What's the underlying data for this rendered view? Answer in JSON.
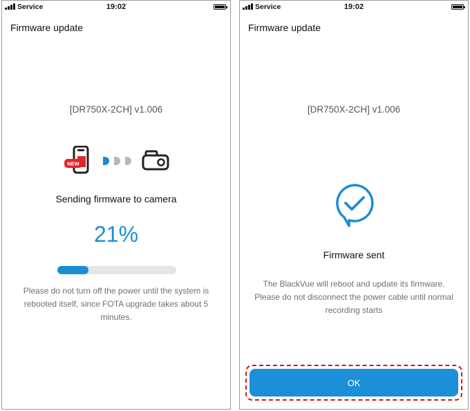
{
  "status_bar": {
    "carrier": "Service",
    "time": "19:02"
  },
  "left_screen": {
    "title": "Firmware update",
    "model": "[DR750X-2CH] v1.006",
    "new_badge": "NEW",
    "sending_text": "Sending firmware to camera",
    "progress_percent_text": "21%",
    "progress_fraction": 0.26,
    "notice": "Please do not turn off the power until the system is rebooted itself, since FOTA upgrade takes about 5 minutes."
  },
  "right_screen": {
    "title": "Firmware update",
    "model": "[DR750X-2CH] v1.006",
    "sent_text": "Firmware sent",
    "notice": "The BlackVue will reboot and update its firmware. Please do not disconnect the power cable until normal recording starts",
    "ok_label": "OK"
  },
  "colors": {
    "accent": "#1a8ed3",
    "highlight": "#d41414",
    "new_badge": "#e0262b"
  },
  "icons": [
    "signal-icon",
    "battery-icon",
    "phone-new-icon",
    "transfer-dots-icon",
    "dashcam-icon",
    "check-bubble-icon"
  ]
}
